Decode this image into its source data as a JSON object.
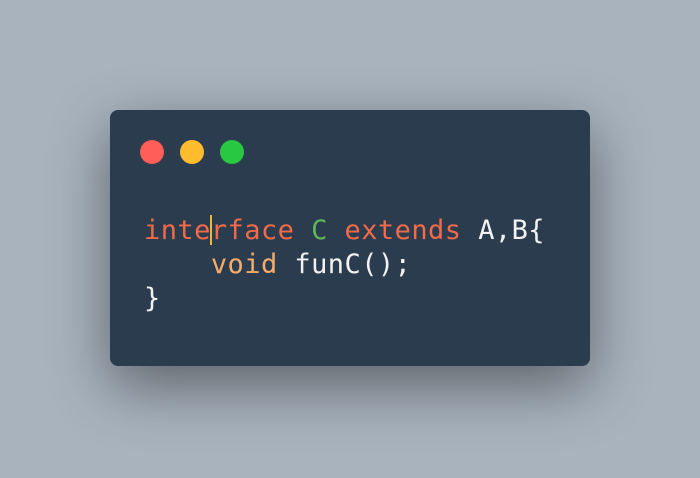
{
  "window": {
    "controls": [
      {
        "name": "close",
        "color": "#ff5f57"
      },
      {
        "name": "minimize",
        "color": "#febc2e"
      },
      {
        "name": "maximize",
        "color": "#28c840"
      }
    ]
  },
  "code": {
    "line1": {
      "kw_before_caret": "inte",
      "kw_after_caret": "rface",
      "class_name": "C",
      "extends": "extends",
      "rest": "A,B{"
    },
    "line2": {
      "indent": "    ",
      "type": "void",
      "rest": "funC();"
    },
    "line3": {
      "text": "}"
    }
  },
  "colors": {
    "background": "#a8b3be",
    "editor": "#2b3c4f",
    "keyword": "#f26a48",
    "class": "#5fb65a",
    "type": "#f7ac6a",
    "text": "#f2f2f2",
    "caret": "#e8b93a"
  }
}
